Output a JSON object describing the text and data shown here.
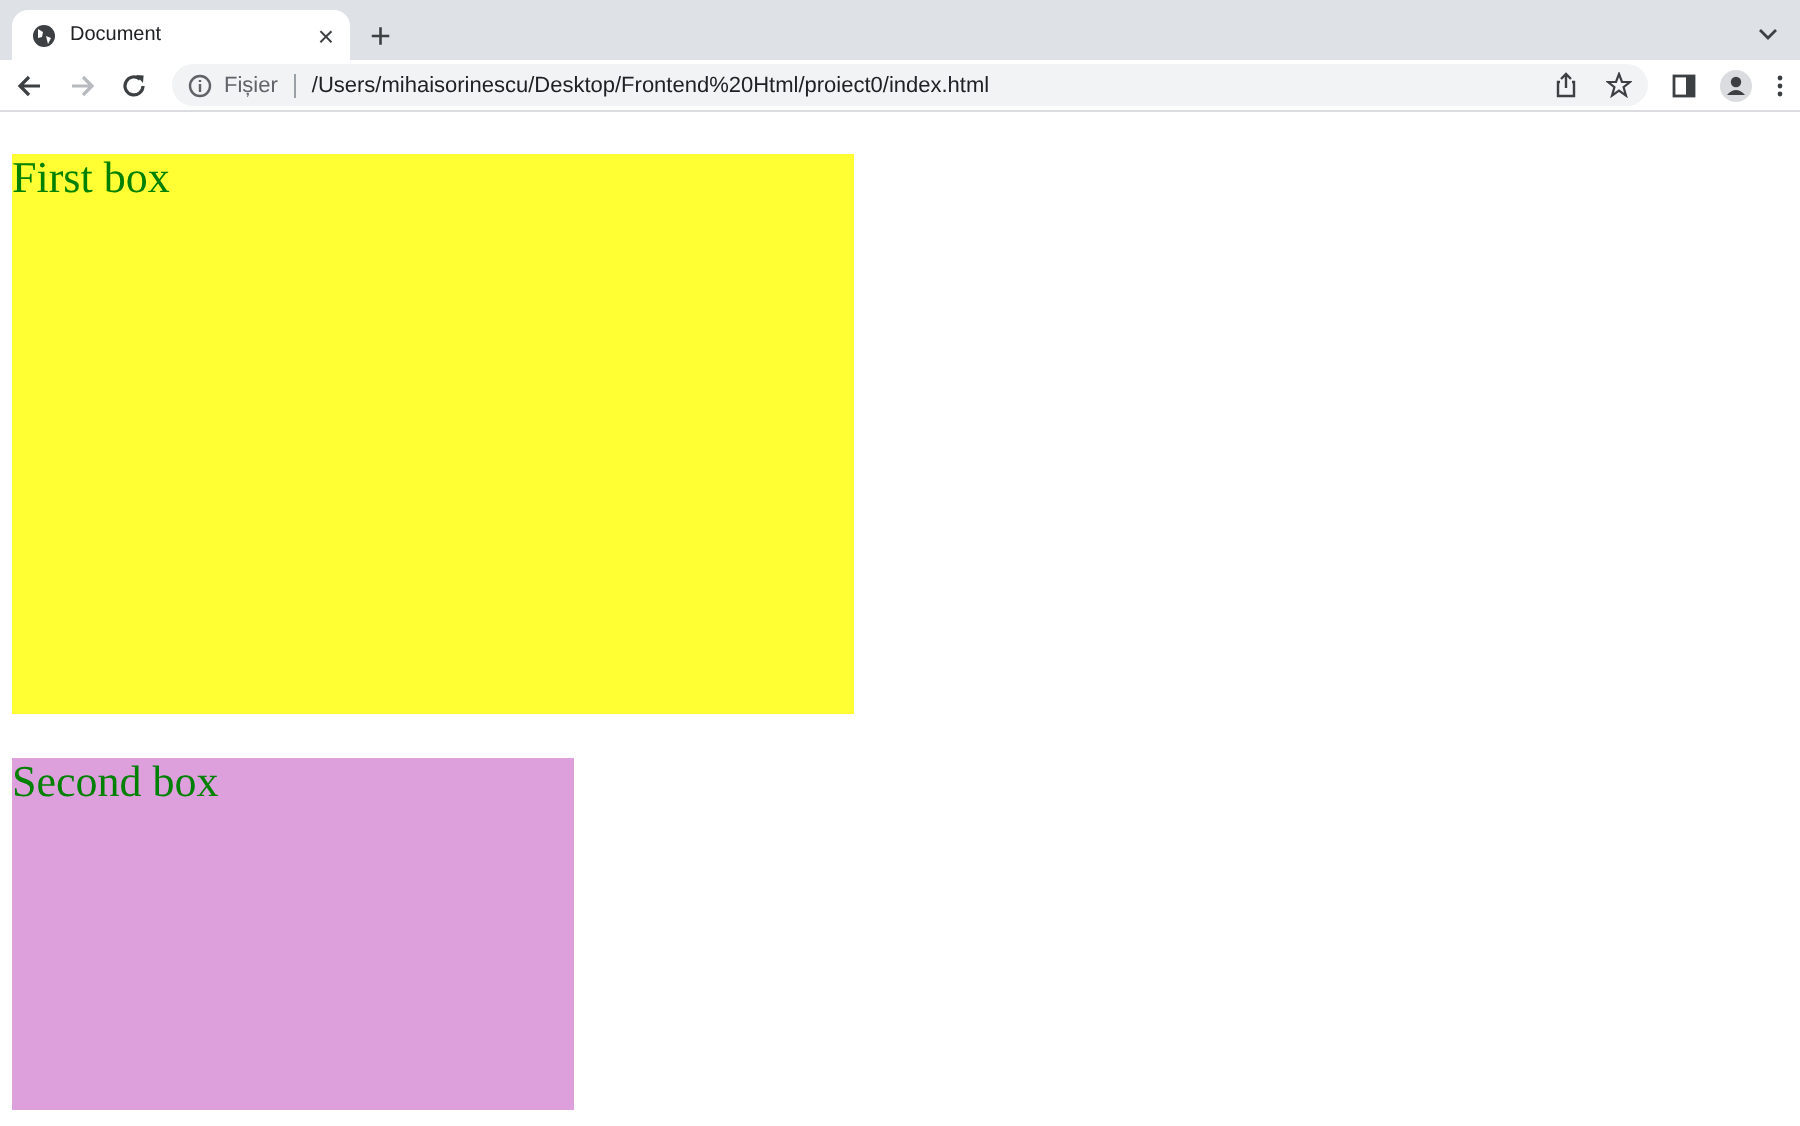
{
  "tab": {
    "title": "Document",
    "close": "×",
    "new_tab": "+"
  },
  "nav": [
    {
      "kind": "back",
      "disabled": false
    },
    {
      "kind": "forward",
      "disabled": true
    },
    {
      "kind": "reload",
      "disabled": false
    }
  ],
  "address": {
    "scheme_label": "Fișier",
    "url": "/Users/mihaisorinescu/Desktop/Frontend%20Html/proiect0/index.html"
  },
  "boxes": [
    {
      "text": "First box",
      "color": "#ffff33",
      "kind": "large"
    },
    {
      "text": "Second box",
      "color": "#dda0dd",
      "kind": "small"
    }
  ]
}
